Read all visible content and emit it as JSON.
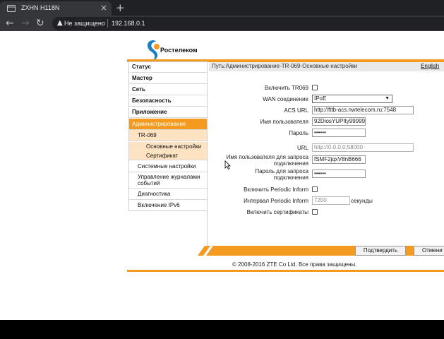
{
  "browser": {
    "tab_title": "ZXHN H118N",
    "tab_close": "×",
    "new_tab": "+",
    "security_label": "Не защищено",
    "url": "192.168.0.1"
  },
  "brand": {
    "logo_text": "Ростелеком",
    "accent_color": "#f39a1f",
    "logo_color": "#1a7fc1"
  },
  "menu": {
    "items": [
      {
        "label": "Статус"
      },
      {
        "label": "Мастер"
      },
      {
        "label": "Сеть"
      },
      {
        "label": "Безопасность"
      },
      {
        "label": "Приложение"
      },
      {
        "label": "Администрирование"
      }
    ],
    "admin_sub": {
      "tr069": "TR-069",
      "basic": "Основные настройки",
      "cert": "Сертификат",
      "system": "Системные настройки",
      "logs": "Управление журналами событий",
      "diag": "Диагностика",
      "ipv6": "Включение IPv6"
    }
  },
  "breadcrumb": {
    "path": "Путь:Администрирование-TR-069-Основные настройки",
    "language": "English"
  },
  "form": {
    "enable_tr069_label": "Включить TR069",
    "wan_label": "WAN соединение",
    "wan_value": "IPoE",
    "acs_url_label": "ACS URL",
    "acs_url_value": "http://fttb-acs.nwtelecom.ru:7548",
    "username_label": "Имя пользователя",
    "username_value": "92DiosYUPIty99999",
    "password_label": "Пароль",
    "password_value": "••••••",
    "url_label": "URL",
    "url_value": "http://0.0.0.0:58000",
    "conn_user_label_1": "Имя пользователя для запроса",
    "conn_user_label_2": "подключения",
    "conn_user_value": "fSMF2jqxV8nB666",
    "conn_pass_label_1": "Пароль для запроса",
    "conn_pass_label_2": "подключения",
    "conn_pass_value": "••••••",
    "periodic_label": "Включить Periodic Inform",
    "interval_label": "Интервал Periodic Inform",
    "interval_value": "7200",
    "interval_unit": "секунды",
    "certs_label": "Включить сертификаты"
  },
  "footer": {
    "apply": "Подтвердить",
    "cancel": "Отмени",
    "copyright": "© 2008-2016 ZTE Co Ltd. Все права защищены."
  }
}
